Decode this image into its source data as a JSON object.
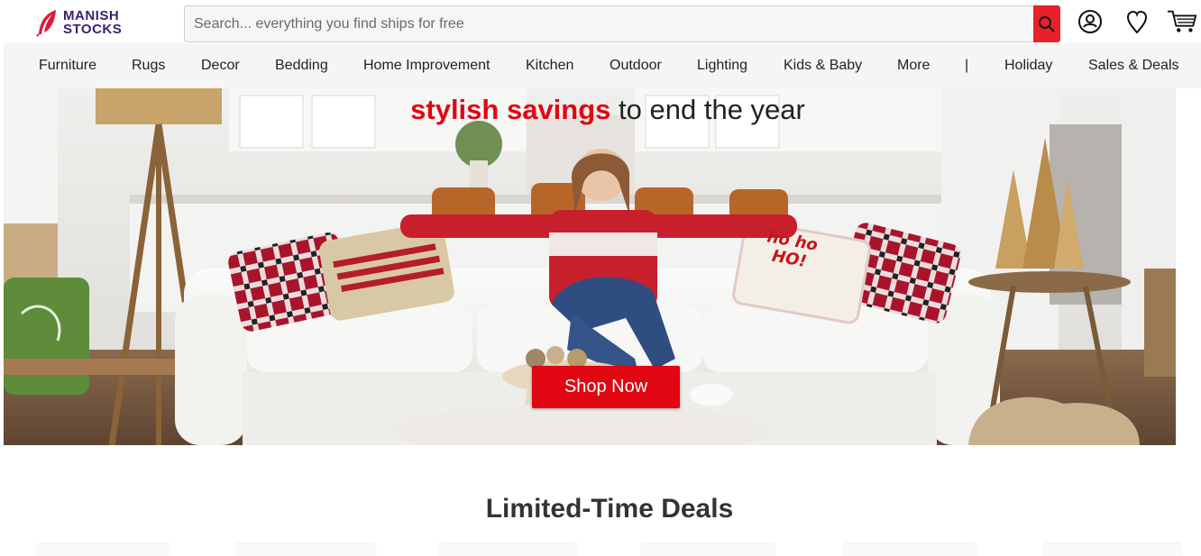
{
  "brand": {
    "line1": "MANISH",
    "line2": "STOCKS"
  },
  "search": {
    "placeholder": "Search... everything you find ships for free"
  },
  "header_icons": [
    "account-icon",
    "wishlist-heart-icon",
    "cart-icon"
  ],
  "nav": {
    "items": [
      {
        "label": "Furniture"
      },
      {
        "label": "Rugs"
      },
      {
        "label": "Decor"
      },
      {
        "label": "Bedding"
      },
      {
        "label": "Home Improvement"
      },
      {
        "label": "Kitchen"
      },
      {
        "label": "Outdoor"
      },
      {
        "label": "Lighting"
      },
      {
        "label": "Kids & Baby"
      },
      {
        "label": "More"
      },
      {
        "label": "|"
      },
      {
        "label": "Holiday"
      },
      {
        "label": "Sales & Deals"
      }
    ]
  },
  "hero": {
    "headline_accent": "stylish savings",
    "headline_rest": " to end the year",
    "cta": "Shop Now",
    "pillow_text": "ho ho HO!"
  },
  "deals": {
    "title": "Limited-Time Deals"
  },
  "colors": {
    "accent": "#e00612",
    "brand": "#3b2070",
    "nav_bg": "#f5f5f5"
  }
}
